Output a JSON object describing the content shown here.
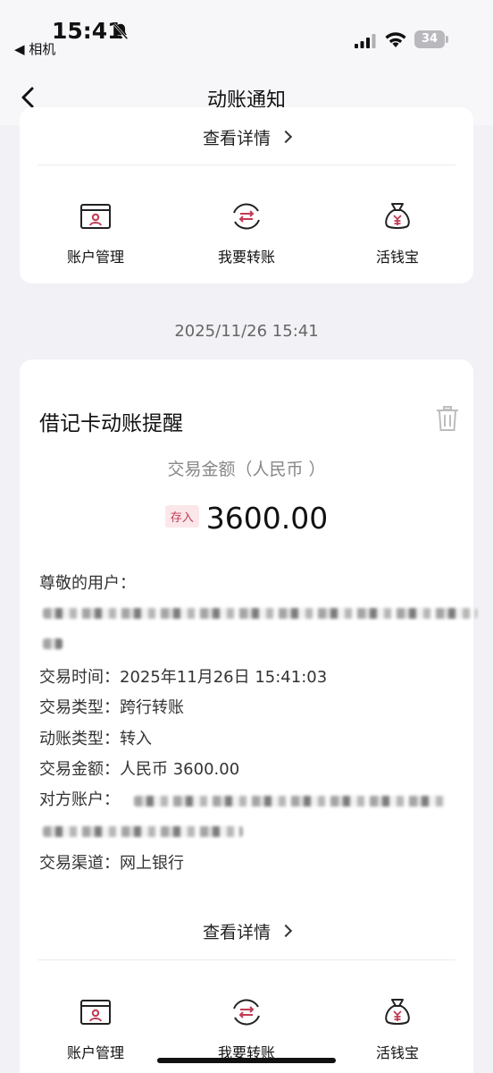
{
  "status_bar": {
    "time": "15:41",
    "back_app": "◀ 相机",
    "battery": "34"
  },
  "nav": {
    "title": "动账通知"
  },
  "top_card": {
    "detail_link": "查看详情",
    "actions": [
      {
        "label": "账户管理"
      },
      {
        "label": "我要转账"
      },
      {
        "label": "活钱宝"
      }
    ]
  },
  "timestamp": "2025/11/26 15:41",
  "message": {
    "title": "借记卡动账提醒",
    "amount_caption": "交易金额（人民币 ）",
    "badge": "存入",
    "amount": "3600.00",
    "greeting": "尊敬的用户：",
    "fields": [
      {
        "text": "交易时间：2025年11月26日 15:41:03"
      },
      {
        "text": "交易类型：跨行转账"
      },
      {
        "text": "动账类型：转入"
      },
      {
        "text": "交易金额：人民币 3600.00"
      },
      {
        "text": "对方账户："
      },
      {
        "text": "交易渠道：网上银行"
      }
    ],
    "detail_link": "查看详情",
    "actions": [
      {
        "label": "账户管理"
      },
      {
        "label": "我要转账"
      },
      {
        "label": "活钱宝"
      }
    ]
  },
  "colors": {
    "accent": "#c23b54",
    "background": "#f1f1f6"
  }
}
